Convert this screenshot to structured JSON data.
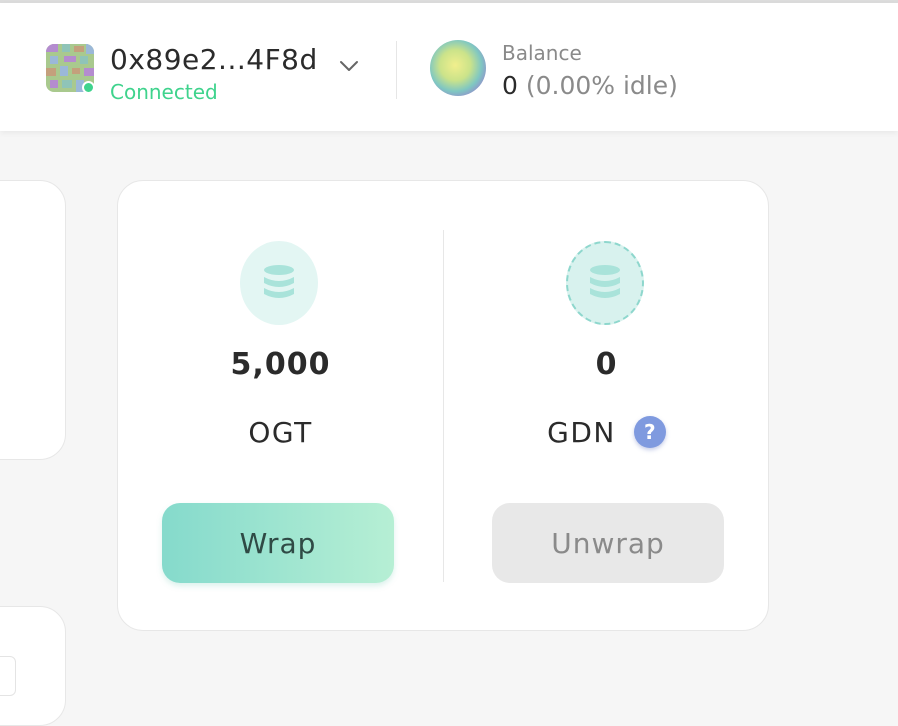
{
  "header": {
    "account": {
      "address": "0x89e2...4F8d",
      "status": "Connected",
      "status_color": "#3fd38d",
      "dropdown_icon": "chevron-down-icon"
    },
    "balance": {
      "label": "Balance",
      "amount": "0",
      "idle_text": "(0.00% idle)",
      "token_icon": "token-orb-icon"
    }
  },
  "wrap_card": {
    "left": {
      "icon": "coin-stack-icon",
      "amount": "5,000",
      "symbol": "OGT",
      "button_label": "Wrap"
    },
    "right": {
      "icon": "coin-stack-dashed-icon",
      "amount": "0",
      "symbol": "GDN",
      "help_icon_label": "?",
      "button_label": "Unwrap"
    }
  },
  "colors": {
    "accent_start": "#85dacc",
    "accent_end": "#b6efd4",
    "help_badge": "#7f9adf",
    "disabled_button": "#e8e8e8"
  }
}
